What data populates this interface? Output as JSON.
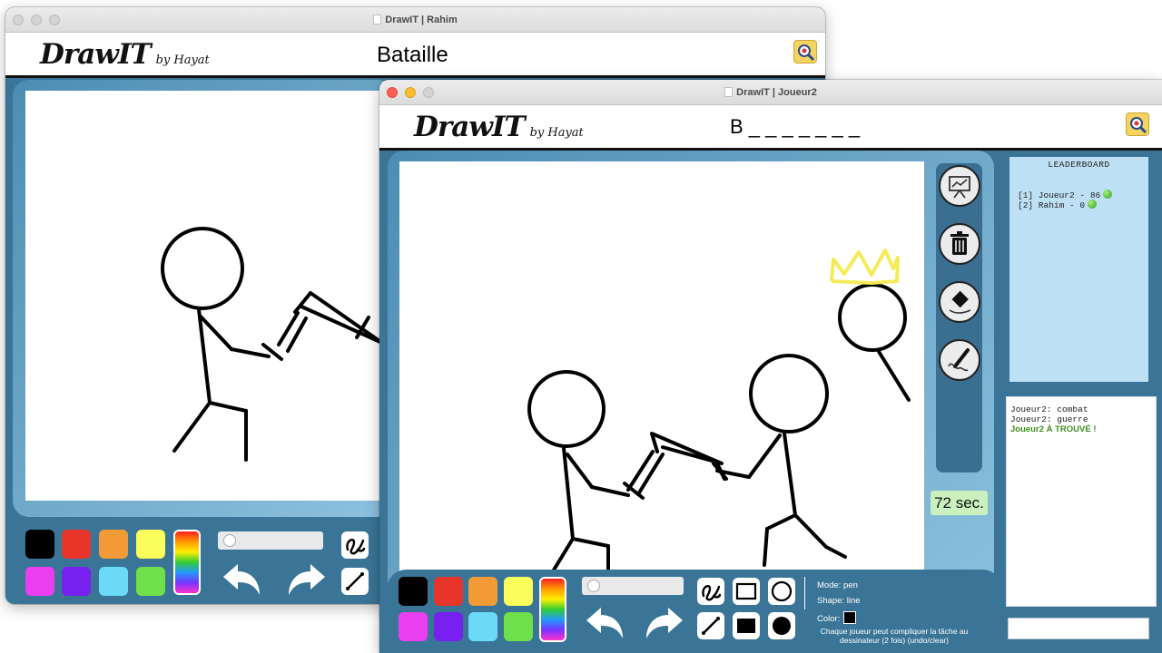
{
  "back_window": {
    "title": "DrawIT | Rahim",
    "logo": "DrawIT",
    "logo_by": "by Hayat",
    "word": "Bataille"
  },
  "front_window": {
    "title": "DrawIT | Joueur2",
    "logo": "DrawIT",
    "logo_by": "by Hayat",
    "word": "B _ _ _ _ _ _ _",
    "timer": "72 sec.",
    "leaderboard": {
      "title": "LEADERBOARD",
      "entries": [
        "[1] Joueur2 - 86",
        "[2] Rahim - 0"
      ]
    },
    "chat": {
      "messages": [
        "Joueur2: combat",
        "Joueur2: guerre"
      ],
      "found": "Joueur2 À TROUVÉ !"
    },
    "chat_input_value": "",
    "status": {
      "mode": "Mode: pen",
      "shape": "Shape: line",
      "color": "Color:",
      "hint": "Chaque joueur peut compliquer la tâche au dessinateur (2 fois) (undo/clear)"
    }
  },
  "palette": [
    "#000000",
    "#e8352a",
    "#f29b36",
    "#fafd5a",
    "#ea3ff0",
    "#7720f0",
    "#6bdaf8",
    "#6ee04a"
  ],
  "colors": {
    "window_blue": "#3a7597",
    "timer_bg": "#c9f0bd",
    "leaderboard_bg": "#bde0f5",
    "found_text": "#3c8f1f"
  },
  "icons": [
    "search-icon",
    "whiteboard-icon",
    "trash-icon",
    "eraser-icon",
    "pen-icon",
    "freehand-icon",
    "line-icon",
    "rectangle-icon",
    "filled-rectangle-icon",
    "circle-icon",
    "filled-circle-icon",
    "undo-icon",
    "redo-icon"
  ]
}
